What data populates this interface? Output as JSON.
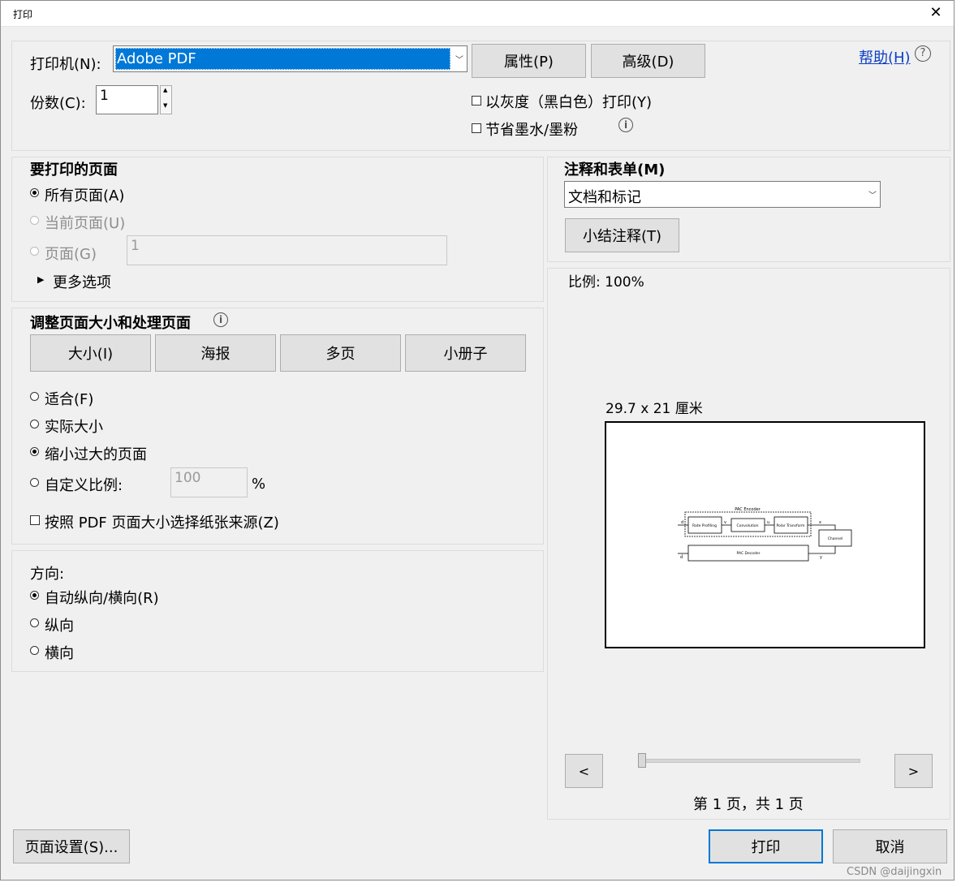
{
  "window": {
    "title": "打印"
  },
  "printer": {
    "label": "打印机(N):",
    "selected": "Adobe PDF",
    "properties_button": "属性(P)",
    "advanced_button": "高级(D)",
    "help_link": "帮助(H)"
  },
  "copies": {
    "label": "份数(C):",
    "value": "1"
  },
  "options": {
    "grayscale": "以灰度（黑白色）打印(Y)",
    "save_ink": "节省墨水/墨粉"
  },
  "pages": {
    "heading": "要打印的页面",
    "all": "所有页面(A)",
    "current": "当前页面(U)",
    "range": "页面(G)",
    "range_value": "1",
    "more": "更多选项"
  },
  "annotations": {
    "heading": "注释和表单(M)",
    "selected": "文档和标记",
    "summarize_button": "小结注释(T)"
  },
  "sizing": {
    "heading": "调整页面大小和处理页面",
    "tabs": [
      "大小(I)",
      "海报",
      "多页",
      "小册子"
    ],
    "fit": "适合(F)",
    "actual": "实际大小",
    "shrink": "缩小过大的页面",
    "custom": "自定义比例:",
    "custom_value": "100",
    "percent": "%",
    "paper_source": "按照 PDF 页面大小选择纸张来源(Z)"
  },
  "orientation": {
    "heading": "方向:",
    "auto": "自动纵向/横向(R)",
    "portrait": "纵向",
    "landscape": "横向"
  },
  "preview": {
    "scale": "比例:  100%",
    "paper_size": "29.7 x 21 厘米",
    "prev_button": "<",
    "next_button": ">",
    "page_info": "第 1 页，共 1 页",
    "diagram": {
      "encoder_title": "PAC Encoder",
      "block1": "Rate Profiling",
      "block2": "Convolution",
      "block3": "Polar Transform",
      "channel": "Channel",
      "decoder": "PAC Decoder",
      "sym_d": "d",
      "sym_v": "v",
      "sym_u": "u",
      "sym_x": "x",
      "sym_y": "y",
      "sym_dhat": "d̂"
    }
  },
  "footer": {
    "page_setup_button": "页面设置(S)...",
    "print_button": "打印",
    "cancel_button": "取消"
  },
  "watermark": "CSDN @daijingxin"
}
